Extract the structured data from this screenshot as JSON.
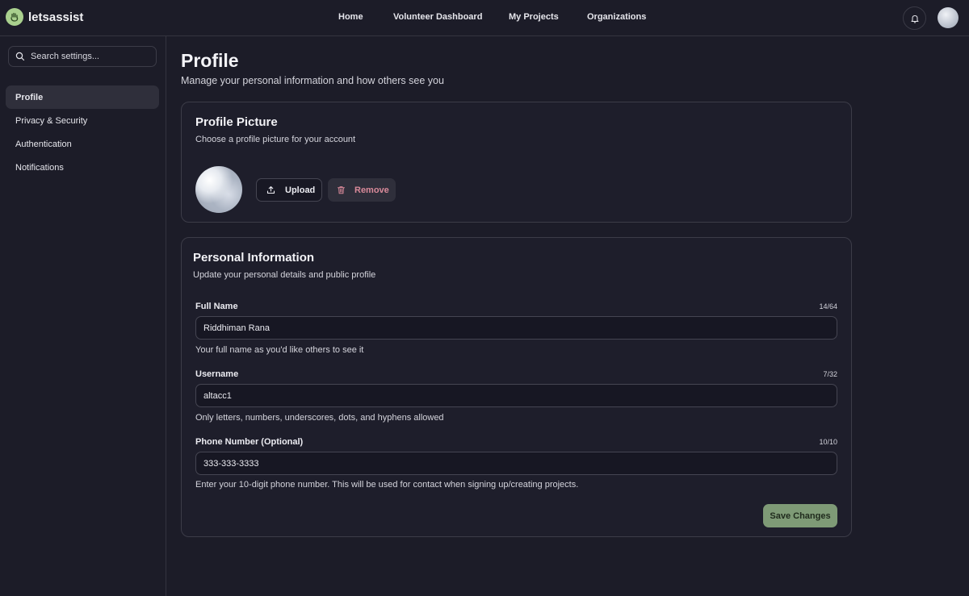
{
  "brand": {
    "name": "letsassist",
    "logo_icon": "hand-icon",
    "logo_color": "#a9d08e"
  },
  "nav": {
    "home": "Home",
    "volunteer_dashboard": "Volunteer Dashboard",
    "my_projects": "My Projects",
    "organizations": "Organizations"
  },
  "sidebar": {
    "search_placeholder": "Search settings...",
    "items": [
      {
        "label": "Profile",
        "active": true
      },
      {
        "label": "Privacy & Security",
        "active": false
      },
      {
        "label": "Authentication",
        "active": false
      },
      {
        "label": "Notifications",
        "active": false
      }
    ]
  },
  "page": {
    "title": "Profile",
    "subtitle": "Manage your personal information and how others see you"
  },
  "picture_card": {
    "title": "Profile Picture",
    "subtitle": "Choose a profile picture for your account",
    "upload_label": "Upload",
    "remove_label": "Remove"
  },
  "info_card": {
    "title": "Personal Information",
    "subtitle": "Update your personal details and public profile",
    "fields": [
      {
        "label": "Full Name",
        "count": "14/64",
        "value": "Riddhiman Rana",
        "help": "Your full name as you'd like others to see it"
      },
      {
        "label": "Username",
        "count": "7/32",
        "value": "altacc1",
        "help": "Only letters, numbers, underscores, dots, and hyphens allowed"
      },
      {
        "label": "Phone Number (Optional)",
        "count": "10/10",
        "value": "333-333-3333",
        "help": "Enter your 10-digit phone number. This will be used for contact when signing up/creating projects."
      }
    ],
    "save_label": "Save Changes"
  },
  "colors": {
    "background": "#1c1c28",
    "save_button": "#7e9a76",
    "remove_text": "#d98a9a"
  }
}
